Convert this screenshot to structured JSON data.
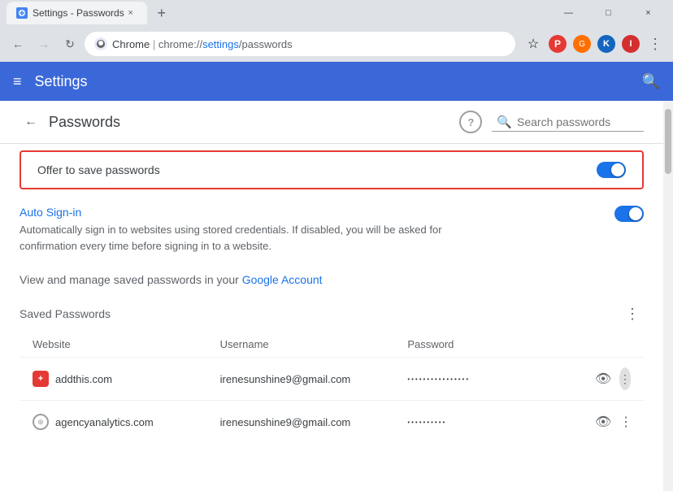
{
  "window": {
    "title": "Settings - Passwords",
    "tab_close": "×",
    "new_tab": "+",
    "controls": {
      "minimize": "—",
      "maximize": "□",
      "close": "×"
    }
  },
  "toolbar": {
    "back_label": "←",
    "forward_label": "→",
    "refresh_label": "↻",
    "browser_name": "Chrome",
    "url_domain": "chrome://",
    "url_path": "settings",
    "url_rest": "/passwords",
    "star_label": "☆",
    "menu_label": "⋮"
  },
  "header": {
    "menu_icon": "≡",
    "title": "Settings",
    "search_icon": "🔍"
  },
  "page": {
    "back_icon": "←",
    "title": "Passwords",
    "help_icon": "?",
    "search_placeholder": "Search passwords"
  },
  "offer_save": {
    "label": "Offer to save passwords",
    "enabled": true
  },
  "auto_signin": {
    "title": "Auto Sign-in",
    "description": "Automatically sign in to websites using stored credentials. If disabled, you will be asked for confirmation every time before signing in to a website.",
    "enabled": true
  },
  "account_link": {
    "text_before": "View and manage saved passwords in your ",
    "link_text": "Google Account",
    "link_url": "#"
  },
  "saved_passwords": {
    "title": "Saved Passwords",
    "more_icon": "⋮",
    "columns": {
      "website": "Website",
      "username": "Username",
      "password": "Password"
    },
    "rows": [
      {
        "site": "addthis.com",
        "favicon_type": "red",
        "favicon_letter": "+",
        "username": "irenesunshine9@gmail.com",
        "password": "••••••••••••••••"
      },
      {
        "site": "agencyanalytics.com",
        "favicon_type": "globe",
        "favicon_letter": "",
        "username": "irenesunshine9@gmail.com",
        "password": "••••••••••"
      }
    ]
  }
}
